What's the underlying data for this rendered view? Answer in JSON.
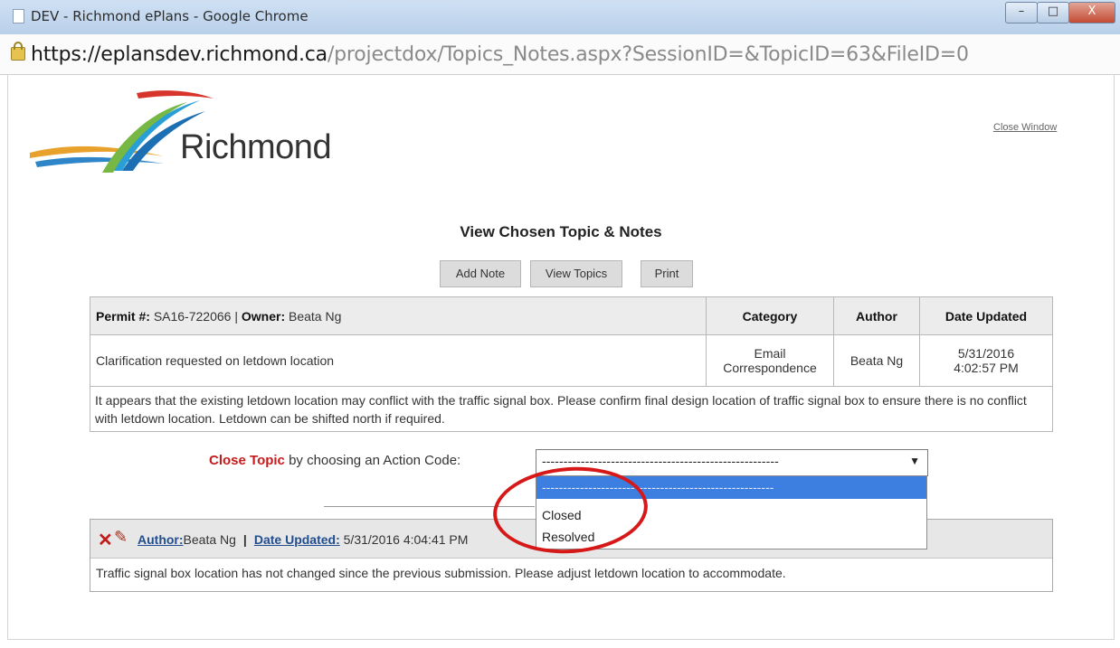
{
  "window": {
    "title": "DEV - Richmond ePlans - Google Chrome",
    "controls": {
      "minimize": "–",
      "maximize": "□",
      "close": "X"
    }
  },
  "address": {
    "host": "https://eplansdev.richmond.ca",
    "path": "/projectdox/Topics_Notes.aspx?SessionID=&TopicID=63&FileID=0"
  },
  "header": {
    "logo_text": "Richmond",
    "close_window": "Close Window"
  },
  "page": {
    "title": "View Chosen Topic & Notes",
    "buttons": {
      "add_note": "Add Note",
      "view_topics": "View Topics",
      "print": "Print"
    }
  },
  "topic": {
    "permit_label": "Permit #:",
    "permit_value": "SA16-722066",
    "separator": "|",
    "owner_label": "Owner:",
    "owner_value": "Beata Ng",
    "col_category": "Category",
    "col_author": "Author",
    "col_date": "Date Updated",
    "subject": "Clarification requested on letdown location",
    "category_line1": "Email",
    "category_line2": "Correspondence",
    "author": "Beata Ng",
    "date_line1": "5/31/2016",
    "date_line2": "4:02:57 PM",
    "description": "It appears that the existing letdown location may conflict with the traffic signal box. Please confirm final design location of traffic signal box to ensure there is no conflict with letdown location. Letdown can be shifted north if required."
  },
  "close_topic": {
    "highlight": "Close Topic",
    "rest": "by choosing an Action Code:",
    "selected": "-------------------------------------------------------",
    "arrow": "▼",
    "options": [
      "-------------------------------------------------------",
      "Closed",
      "Resolved"
    ]
  },
  "note": {
    "author_label": "Author:",
    "author_value": "Beata Ng",
    "separator": "|",
    "date_label": "Date Updated:",
    "date_value": "5/31/2016 4:04:41 PM",
    "body": "Traffic signal box location has not changed since the previous submission. Please adjust letdown location to accommodate."
  },
  "colors": {
    "accent_red": "#c61a1a",
    "link_blue": "#224e8f",
    "dropdown_highlight": "#3d7fe0"
  }
}
